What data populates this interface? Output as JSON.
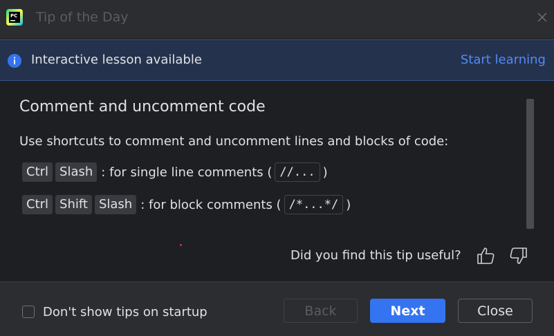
{
  "window": {
    "title": "Tip of the Day",
    "app_logo_text": "PC"
  },
  "banner": {
    "text": "Interactive lesson available",
    "link": "Start learning"
  },
  "tip": {
    "title": "Comment and uncomment code",
    "description": "Use shortcuts to comment and uncomment lines and blocks of code:",
    "shortcuts": [
      {
        "keys": [
          "Ctrl",
          "Slash"
        ],
        "text_before": ": for single line comments (",
        "code": "//...",
        "text_after": ")"
      },
      {
        "keys": [
          "Ctrl",
          "Shift",
          "Slash"
        ],
        "text_before": ": for block comments (",
        "code": "/*...*/",
        "text_after": ")"
      }
    ]
  },
  "feedback": {
    "question": "Did you find this tip useful?",
    "thumbs_up_icon": "thumbs-up-icon",
    "thumbs_down_icon": "thumbs-down-icon"
  },
  "footer": {
    "checkbox_label": "Don't show tips on startup",
    "checkbox_checked": false,
    "back_label": "Back",
    "next_label": "Next",
    "close_label": "Close"
  },
  "colors": {
    "accent": "#3574f0",
    "link": "#548af7",
    "banner_bg": "#25324d"
  }
}
